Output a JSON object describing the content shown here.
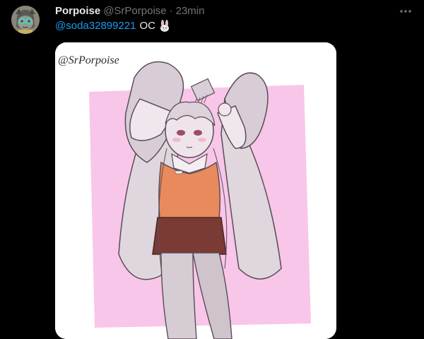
{
  "tweet": {
    "author": {
      "display_name": "Porpoise",
      "handle": "@SrPorpoise",
      "avatar_icon": "avatar-image"
    },
    "separator": "·",
    "timestamp": "23min",
    "more_icon": "more-horizontal-icon",
    "text": {
      "mention": "@soda32899221",
      "body": "OC",
      "emoji": "rabbit-face-emoji"
    },
    "media": {
      "signature": "@SrPorpoise",
      "kind": "illustration"
    }
  },
  "colors": {
    "background": "#000000",
    "text_primary": "#e7e9ea",
    "text_secondary": "#71767b",
    "link": "#1d9bf0",
    "art_pink_backdrop": "#f8c6e8",
    "art_sweater": "#e98a5c",
    "art_skirt": "#7a3b35"
  }
}
